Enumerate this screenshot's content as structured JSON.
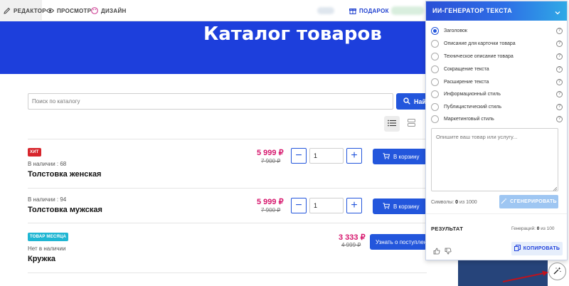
{
  "toolbar": {
    "editor_label": "РЕДАКТОР",
    "preview_label": "ПРОСМОТР",
    "design_label": "ДИЗАЙН",
    "gift_label": "ПОДАРОК"
  },
  "hero": {
    "title": "Каталог товаров"
  },
  "search": {
    "placeholder": "Поиск по каталогу",
    "button_label": "Най"
  },
  "products": [
    {
      "badge": "ХИТ",
      "badge_color": "#d7262d",
      "stock": "В наличии : 68",
      "name": "Толстовка женская",
      "price": "5 999 ₽",
      "old_price": "7 900 ₽",
      "qty": "1",
      "button": "В корзину"
    },
    {
      "badge": "",
      "stock": "В наличии : 94",
      "name": "Толстовка мужская",
      "price": "5 999 ₽",
      "old_price": "7 900 ₽",
      "qty": "1",
      "button": "В корзину"
    },
    {
      "badge": "ТОВАР МЕСЯЦА",
      "badge_color": "#1fb6d3",
      "stock": "Нет в наличии",
      "name": "Кружка",
      "price": "3 333 ₽",
      "old_price": "4 999 ₽",
      "button": "Узнать о поступлении"
    }
  ],
  "ai_panel": {
    "title": "ИИ-ГЕНЕРАТОР ТЕКСТА",
    "options": [
      {
        "label": "Заголовок",
        "selected": true
      },
      {
        "label": "Описание для карточки товара",
        "selected": false
      },
      {
        "label": "Техническое описание товара",
        "selected": false
      },
      {
        "label": "Сокращение текста",
        "selected": false
      },
      {
        "label": "Расширение текста",
        "selected": false
      },
      {
        "label": "Информационный стиль",
        "selected": false
      },
      {
        "label": "Публицистический стиль",
        "selected": false
      },
      {
        "label": "Маркетинговый стиль",
        "selected": false
      }
    ],
    "textarea_placeholder": "Опишите ваш товар или услугу...",
    "chars_prefix": "Символы:",
    "chars_count": "0",
    "chars_suffix": "из 1000",
    "generate_label": "СГЕНЕРИРОВАТЬ",
    "result_label": "РЕЗУЛЬТАТ",
    "generations_prefix": "Генераций:",
    "generations_count": "0",
    "generations_suffix": "из 100",
    "copy_label": "КОПИРОВАТЬ"
  },
  "colors": {
    "brand_blue": "#1d3fdc",
    "button_blue": "#2356dc",
    "price_pink": "#d6156c",
    "arrow_red": "#c1121c"
  }
}
